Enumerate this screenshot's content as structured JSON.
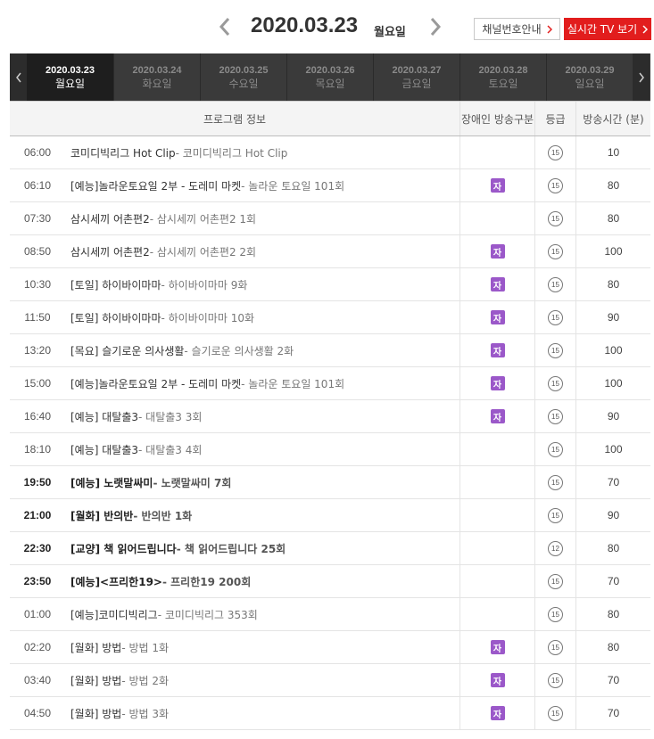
{
  "header": {
    "date": "2020.03.23",
    "day_of_week": "월요일",
    "channel_guide_label": "채널번호안내",
    "live_tv_label": "실시간 TV 보기"
  },
  "date_tabs": [
    {
      "date": "2020.03.23",
      "dow": "월요일",
      "active": true
    },
    {
      "date": "2020.03.24",
      "dow": "화요일",
      "active": false
    },
    {
      "date": "2020.03.25",
      "dow": "수요일",
      "active": false
    },
    {
      "date": "2020.03.26",
      "dow": "목요일",
      "active": false
    },
    {
      "date": "2020.03.27",
      "dow": "금요일",
      "active": false
    },
    {
      "date": "2020.03.28",
      "dow": "토요일",
      "active": false
    },
    {
      "date": "2020.03.29",
      "dow": "일요일",
      "active": false
    }
  ],
  "table": {
    "headers": {
      "program": "프로그램 정보",
      "accessibility": "장애인 방송구분",
      "rating": "등급",
      "duration": "방송시간 (분)"
    },
    "rows": [
      {
        "time": "06:00",
        "title": "코미디빅리그 Hot Clip",
        "sub": " - 코미디빅리그 Hot Clip",
        "ja": false,
        "rating": "15",
        "duration": "10",
        "bold": false
      },
      {
        "time": "06:10",
        "title": "[예능]놀라운토요일 2부 - 도레미 마켓",
        "sub": " - 놀라운 토요일 101회",
        "ja": true,
        "rating": "15",
        "duration": "80",
        "bold": false
      },
      {
        "time": "07:30",
        "title": "삼시세끼 어촌편2",
        "sub": " - 삼시세끼 어촌편2 1회",
        "ja": false,
        "rating": "15",
        "duration": "80",
        "bold": false
      },
      {
        "time": "08:50",
        "title": "삼시세끼 어촌편2",
        "sub": " - 삼시세끼 어촌편2 2회",
        "ja": true,
        "rating": "15",
        "duration": "100",
        "bold": false
      },
      {
        "time": "10:30",
        "title": "[토일] 하이바이마마",
        "sub": " - 하이바이마마 9화",
        "ja": true,
        "rating": "15",
        "duration": "80",
        "bold": false
      },
      {
        "time": "11:50",
        "title": "[토일] 하이바이마마",
        "sub": " - 하이바이마마 10화",
        "ja": true,
        "rating": "15",
        "duration": "90",
        "bold": false
      },
      {
        "time": "13:20",
        "title": "[목요] 슬기로운 의사생활",
        "sub": " - 슬기로운 의사생활 2화",
        "ja": true,
        "rating": "15",
        "duration": "100",
        "bold": false
      },
      {
        "time": "15:00",
        "title": "[예능]놀라운토요일 2부 - 도레미 마켓",
        "sub": " - 놀라운 토요일 101회",
        "ja": true,
        "rating": "15",
        "duration": "100",
        "bold": false
      },
      {
        "time": "16:40",
        "title": "[예능] 대탈출3",
        "sub": " - 대탈출3 3회",
        "ja": true,
        "rating": "15",
        "duration": "90",
        "bold": false
      },
      {
        "time": "18:10",
        "title": "[예능] 대탈출3",
        "sub": " - 대탈출3 4회",
        "ja": false,
        "rating": "15",
        "duration": "100",
        "bold": false
      },
      {
        "time": "19:50",
        "title": "[예능] 노랫말싸미",
        "sub": " - 노랫말싸미 7회",
        "ja": false,
        "rating": "15",
        "duration": "70",
        "bold": true
      },
      {
        "time": "21:00",
        "title": "[월화] 반의반",
        "sub": " - 반의반 1화",
        "ja": false,
        "rating": "15",
        "duration": "90",
        "bold": true
      },
      {
        "time": "22:30",
        "title": "[교양] 책 읽어드립니다",
        "sub": " - 책 읽어드립니다 25회",
        "ja": false,
        "rating": "12",
        "duration": "80",
        "bold": true
      },
      {
        "time": "23:50",
        "title": "[예능]<프리한19>",
        "sub": " - 프리한19 200회",
        "ja": false,
        "rating": "15",
        "duration": "70",
        "bold": true
      },
      {
        "time": "01:00",
        "title": "[예능]코미디빅리그",
        "sub": " - 코미디빅리그 353회",
        "ja": false,
        "rating": "15",
        "duration": "80",
        "bold": false
      },
      {
        "time": "02:20",
        "title": "[월화] 방법",
        "sub": " - 방법 1화",
        "ja": true,
        "rating": "15",
        "duration": "80",
        "bold": false
      },
      {
        "time": "03:40",
        "title": "[월화] 방법",
        "sub": " - 방법 2화",
        "ja": true,
        "rating": "15",
        "duration": "70",
        "bold": false
      },
      {
        "time": "04:50",
        "title": "[월화] 방법",
        "sub": " - 방법 3화",
        "ja": true,
        "rating": "15",
        "duration": "70",
        "bold": false
      }
    ],
    "ja_label": "자"
  },
  "icons": {
    "prev_date": "chevron-left-icon",
    "next_date": "chevron-right-icon",
    "button_arrow": "chevron-right-icon",
    "rating": "rating-circle-icon"
  },
  "colors": {
    "live_button": "#e21d1d",
    "nav_bg": "#3a3a3a",
    "active_tab": "#1e1e1e",
    "ja_badge": "#9b58c9"
  }
}
